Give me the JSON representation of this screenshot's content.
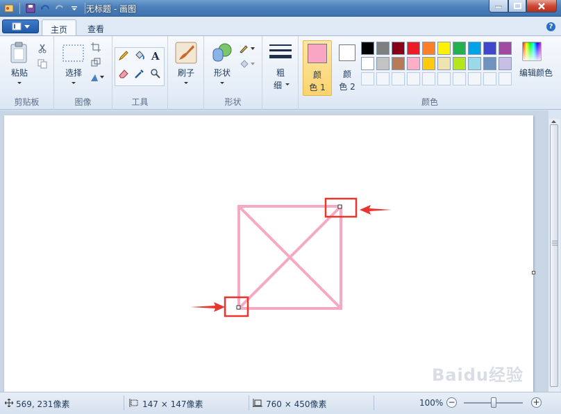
{
  "window": {
    "title": "无标题 - 画图"
  },
  "tabs": [
    {
      "label": "主页"
    },
    {
      "label": "查看"
    }
  ],
  "ribbon": {
    "clipboard": {
      "paste": "粘贴",
      "group": "剪贴板"
    },
    "image": {
      "select": "选择",
      "group": "图像"
    },
    "tools": {
      "group": "工具"
    },
    "brushes": {
      "label": "刷子"
    },
    "shapes": {
      "label": "形状",
      "group": "形状"
    },
    "size": {
      "label_line1": "粗",
      "label_line2": "细"
    },
    "colors": {
      "color1_line1": "颜",
      "color1_line2": "色 1",
      "color2_line1": "颜",
      "color2_line2": "色 2",
      "edit": "编辑颜色",
      "group": "颜色",
      "color1_value": "#f9a6c4",
      "color2_value": "#ffffff",
      "palette_row1": [
        "#000000",
        "#7f7f7f",
        "#880015",
        "#ed1c24",
        "#ff7f27",
        "#fff200",
        "#22b14c",
        "#00a2e8",
        "#3f48cc",
        "#a349a4"
      ],
      "palette_row2": [
        "#ffffff",
        "#c3c3c3",
        "#b97a57",
        "#ffaec9",
        "#ffc90e",
        "#efe4b0",
        "#b5e61d",
        "#99d9ea",
        "#7092be",
        "#c8bfe7"
      ]
    }
  },
  "drawing": {
    "stroke_color": "#f6a9c3"
  },
  "status": {
    "cursor_pos": "569, 231像素",
    "selection_size": "147 × 147像素",
    "canvas_size": "760 × 450像素",
    "zoom": "100%"
  },
  "watermark": "Baidu经验"
}
